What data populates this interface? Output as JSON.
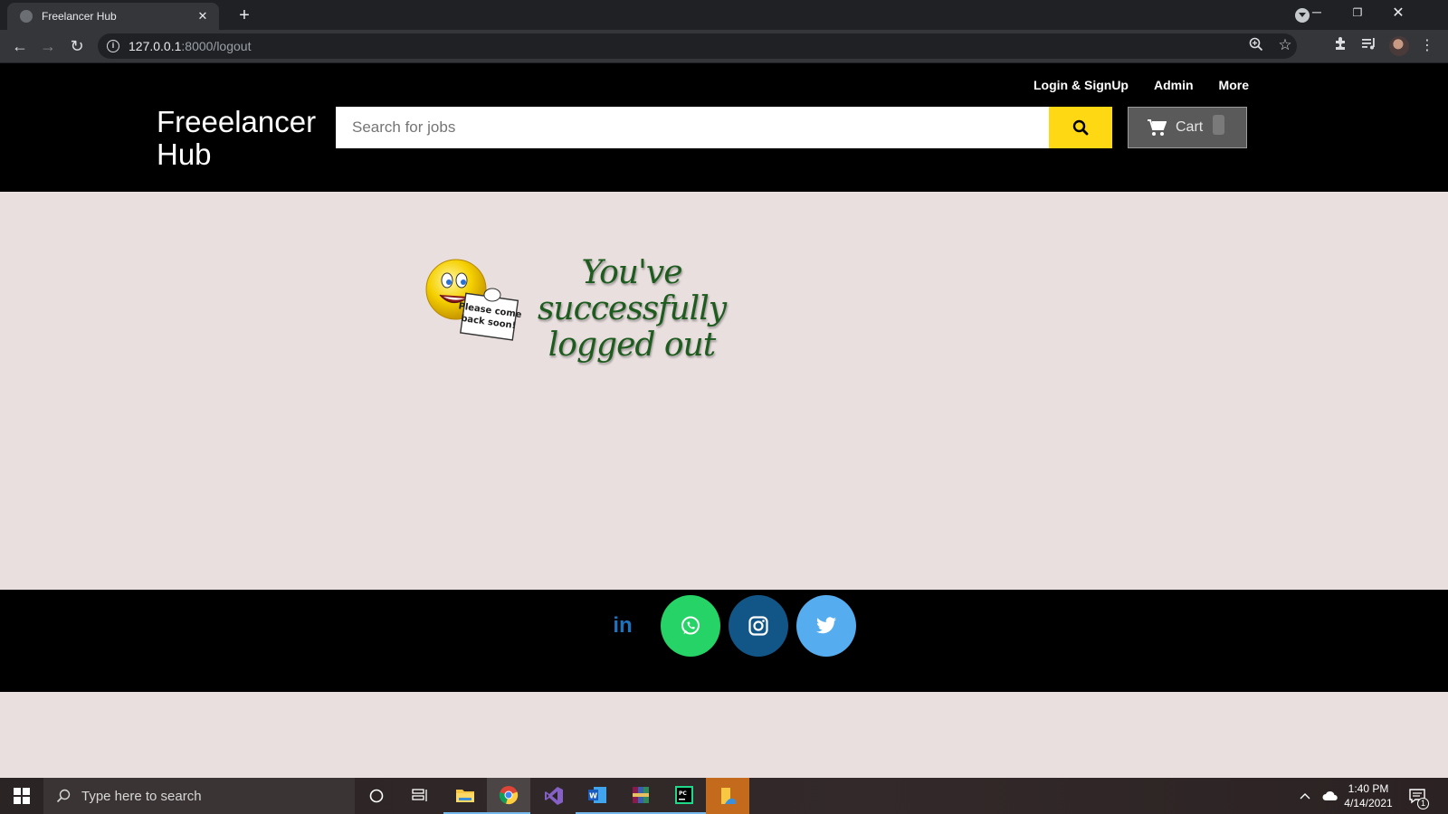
{
  "browser": {
    "tab_title": "Freelancer Hub",
    "url_host": "127.0.0.1",
    "url_rest": ":8000/logout"
  },
  "header": {
    "brand": "Freeelancer Hub",
    "nav": [
      "Login & SignUp",
      "Admin",
      "More"
    ],
    "search_placeholder": "Search for jobs",
    "cart_label": "Cart"
  },
  "main": {
    "message_line1": "You've successfully",
    "message_line2": "logged out",
    "sign_line1": "Please come",
    "sign_line2": "back soon!"
  },
  "footer": {
    "social": [
      {
        "name": "linkedin",
        "color": "#1e73be",
        "text": "in"
      },
      {
        "name": "whatsapp",
        "color": "#25d366"
      },
      {
        "name": "instagram",
        "color": "#125688"
      },
      {
        "name": "twitter",
        "color": "#55acee"
      }
    ]
  },
  "taskbar": {
    "search_placeholder": "Type here to search",
    "time": "1:40 PM",
    "date": "4/14/2021",
    "notification_count": "1"
  },
  "colors": {
    "accent_yellow": "#ffd814",
    "page_bg": "#e9dfdf",
    "header_bg": "#000000"
  }
}
